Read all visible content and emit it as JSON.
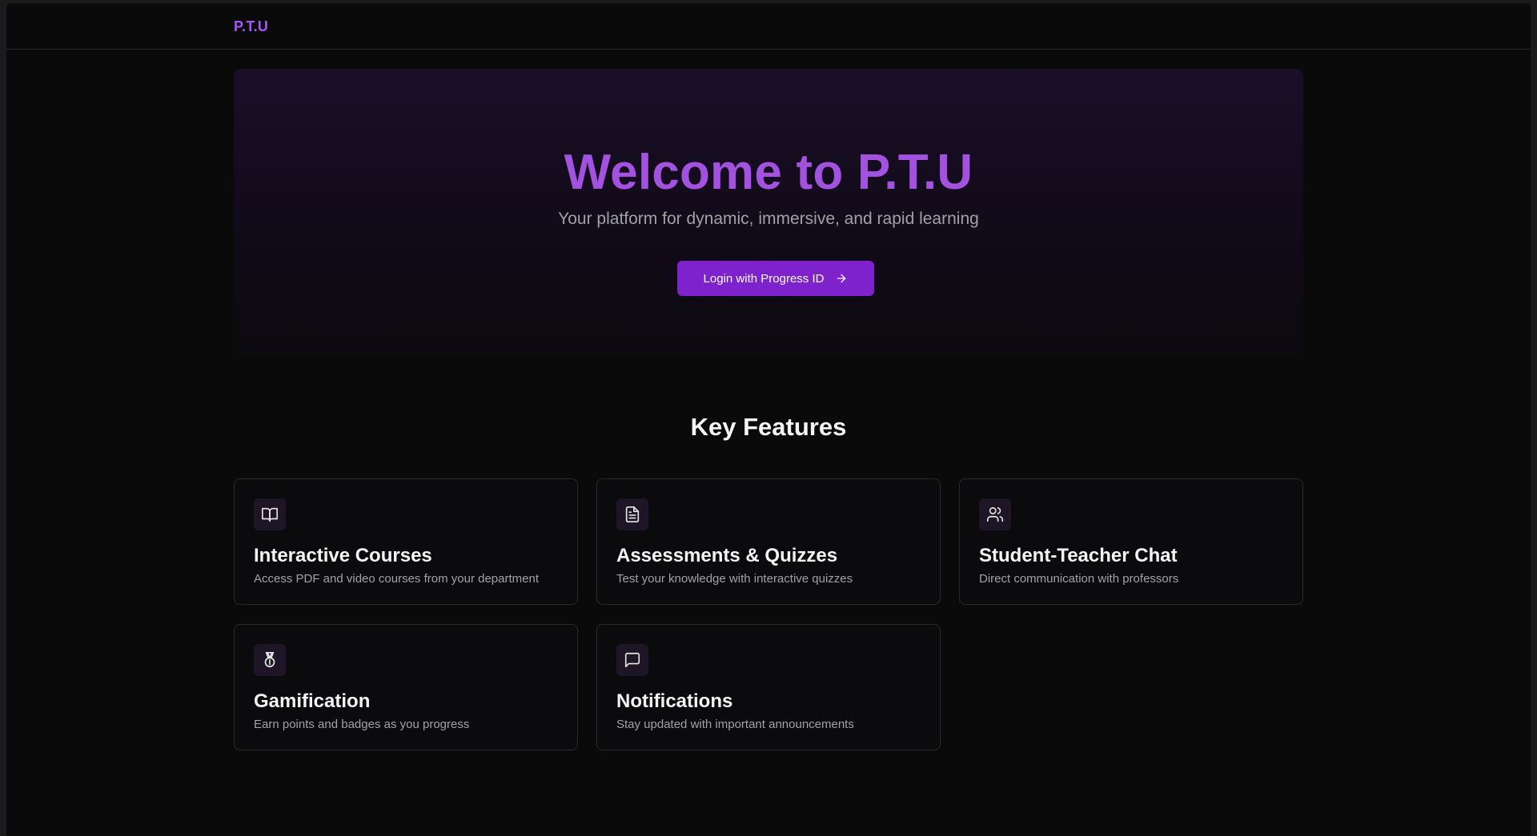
{
  "header": {
    "brand": "P.T.U"
  },
  "hero": {
    "title": "Welcome to P.T.U",
    "subtitle": "Your platform for dynamic, immersive, and rapid learning",
    "login_label": "Login with Progress ID",
    "login_icon": "arrow-right-icon"
  },
  "features": {
    "title": "Key Features",
    "items": [
      {
        "icon": "book-open-icon",
        "title": "Interactive Courses",
        "description": "Access PDF and video courses from your department"
      },
      {
        "icon": "file-text-icon",
        "title": "Assessments & Quizzes",
        "description": "Test your knowledge with interactive quizzes"
      },
      {
        "icon": "users-icon",
        "title": "Student-Teacher Chat",
        "description": "Direct communication with professors"
      },
      {
        "icon": "medal-icon",
        "title": "Gamification",
        "description": "Earn points and badges as you progress"
      },
      {
        "icon": "message-square-icon",
        "title": "Notifications",
        "description": "Stay updated with important announcements"
      }
    ]
  },
  "colors": {
    "accent": "#a855f7",
    "button": "#7e22ce",
    "background": "#0a0a0b"
  }
}
